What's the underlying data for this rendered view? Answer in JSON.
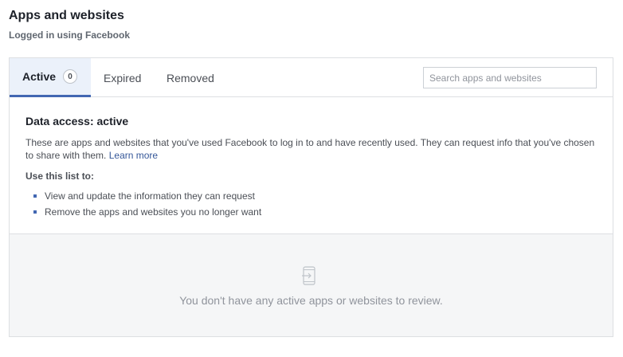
{
  "header": {
    "title": "Apps and websites",
    "subtitle": "Logged in using Facebook"
  },
  "tabs": [
    {
      "label": "Active",
      "count": "0",
      "selected": true
    },
    {
      "label": "Expired",
      "selected": false
    },
    {
      "label": "Removed",
      "selected": false
    }
  ],
  "search": {
    "placeholder": "Search apps and websites",
    "value": ""
  },
  "info": {
    "heading": "Data access: active",
    "description": "These are apps and websites that you've used Facebook to log in to and have recently used. They can request info that you've chosen to share with them.",
    "learn_more": "Learn more",
    "use_heading": "Use this list to:",
    "items": [
      "View and update the information they can request",
      "Remove the apps and websites you no longer want"
    ]
  },
  "empty_state": {
    "icon": "device-login-icon",
    "message": "You don't have any active apps or websites to review."
  },
  "colors": {
    "accent": "#4267b2",
    "link": "#365899",
    "tab_active_bg": "#ebf1fa",
    "empty_bg": "#f5f6f7"
  }
}
